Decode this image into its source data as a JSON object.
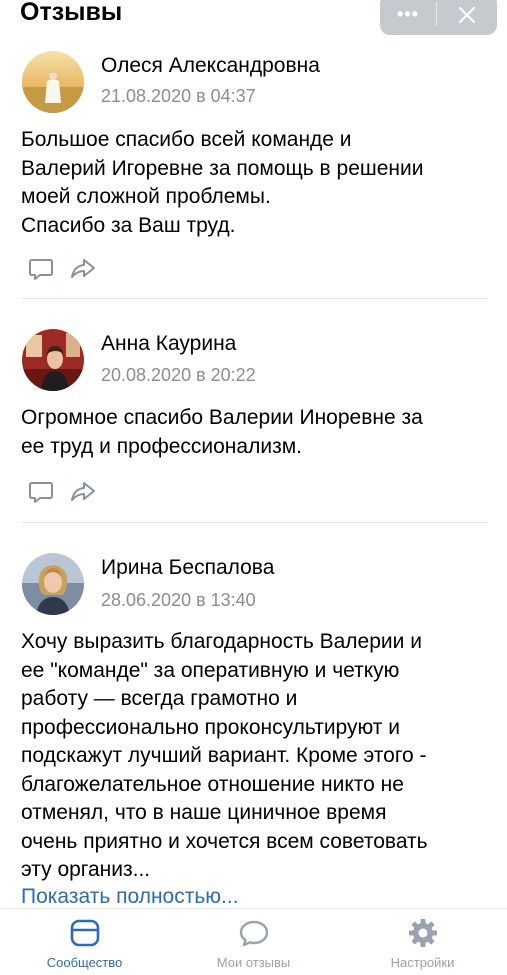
{
  "header": {
    "title": "Отзывы",
    "more_glyph": "•••",
    "more_icon": "more-dots-icon",
    "close_icon": "close-icon"
  },
  "reviews": [
    {
      "author": "Олеся Александровна",
      "date": "21.08.2020 в 04:37",
      "text": "Большое спасибо всей команде и\nВалерий Игоревне за помощь в решении\nмоей сложной проблемы.\nСпасибо за Ваш труд.",
      "avatar_desc": "avatar-field"
    },
    {
      "author": "Анна Каурина",
      "date": "20.08.2020 в 20:22",
      "text": "Огромное спасибо Валерии Инoревне за\nее труд и профессионализм.",
      "avatar_desc": "avatar-woman-red-room"
    },
    {
      "author": "Ирина Беспалова",
      "date": "28.06.2020 в 13:40",
      "text": "Хочу выразить благодарность Валерии и\nее \"команде\" за оперативную и четкую\nработу — всегда грамотно и\nпрофессионально проконсультируют и\nподскажут лучший вариант. Кроме этого -\nблагожелательное отношение никто не\nотменял, что в наше циничное время\nочень приятно и хочется всем советовать\nэту организ...",
      "avatar_desc": "avatar-woman-blonde"
    }
  ],
  "show_more": "Показать полностью...",
  "tabs": [
    {
      "label": "Сообщество",
      "icon": "community-icon",
      "active": true
    },
    {
      "label": "Мои отзывы",
      "icon": "chat-bubble-icon",
      "active": false
    },
    {
      "label": "Настройки",
      "icon": "gear-icon",
      "active": false
    }
  ],
  "colors": {
    "accent": "#2a6cb5",
    "date": "#8a8d91",
    "inactive": "#99a2ad",
    "pill": "#c6c9cd"
  }
}
